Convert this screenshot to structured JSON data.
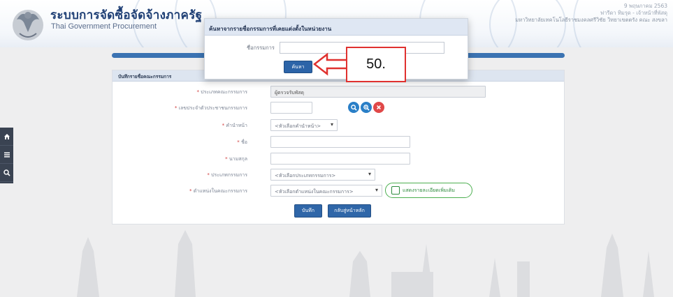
{
  "header": {
    "site_title": "ระบบการจัดซื้อจัดจ้างภาครัฐ",
    "site_subtitle": "Thai Government Procurement",
    "user_line1": "9 พฤษภาคม 2563",
    "user_line2": "ฟารีดา ทิมรุด - เจ้าหน้าที่พัสดุ",
    "user_line3": "มหาวิทยาลัยเทคโนโลยีราชมงคลศรีวิชัย วิทยาเขตตรัง คณะ สงขลา"
  },
  "sidebar": {
    "items": [
      {
        "icon": "home-icon",
        "glyph": "⌂"
      },
      {
        "icon": "menu-icon",
        "glyph": "≡"
      },
      {
        "icon": "search-icon",
        "glyph": "⌕"
      }
    ]
  },
  "form": {
    "header": "บันทึกรายชื่อคณะกรรมการ",
    "fields": {
      "committee_type": {
        "label": "ประเภทคณะกรรมการ",
        "value": "ผู้ตรวจรับพัสดุ"
      },
      "committee_id": {
        "label": "เลขประจำตัวประชาชนกรรมการ",
        "value": ""
      },
      "prefix": {
        "label": "คำนำหน้า",
        "value": "<หัวเลือกคำนำหน้า>"
      },
      "first_name": {
        "label": "ชื่อ",
        "value": ""
      },
      "last_name": {
        "label": "นามสกุล",
        "value": ""
      },
      "member_type": {
        "label": "ประเภทกรรมการ",
        "value": "<หัวเลือกประเภทกรรมการ>"
      },
      "position": {
        "label": "ตำแหน่งในคณะกรรมการ",
        "value": "<หัวเลือกตำแหน่งในคณะกรรมการ>"
      }
    },
    "more_details_button": "แสดงรายละเอียดเพิ่มเติม",
    "save_button": "บันทึก",
    "back_button": "กลับสู่หน้าหลัก"
  },
  "modal": {
    "title": "ค้นหาจากรายชื่อกรรมการที่เคยแต่งตั้งในหน่วยงาน",
    "name_label": "ชื่อกรรมการ",
    "name_value": "",
    "search_button": "ค้นหา"
  },
  "annotation": {
    "step_label": "50.",
    "color": "#e0312f"
  },
  "colors": {
    "primary_blue": "#2f66a8",
    "header_blue": "#3b73b2",
    "nav_dark": "#3a4352",
    "search_btn": "#2a7fc7",
    "add_btn": "#2a7fc7",
    "clear_btn": "#e04848"
  }
}
